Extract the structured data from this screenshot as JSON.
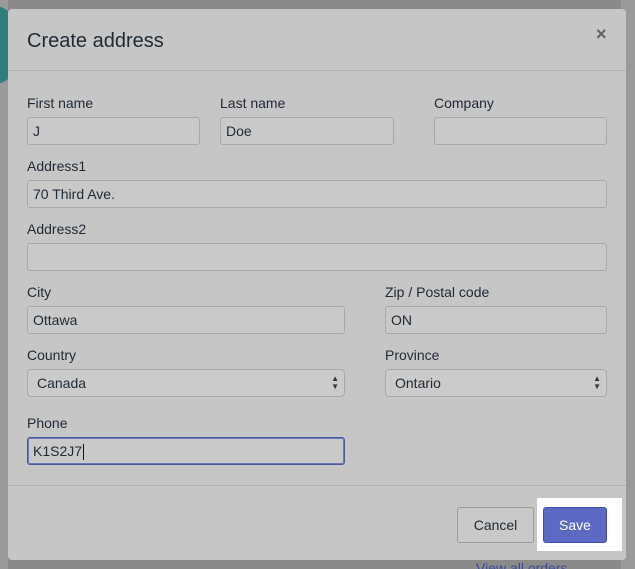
{
  "modal": {
    "title": "Create address",
    "close_glyph": "×"
  },
  "form": {
    "first_name": {
      "label": "First name",
      "value": "J"
    },
    "last_name": {
      "label": "Last name",
      "value": "Doe"
    },
    "company": {
      "label": "Company",
      "value": ""
    },
    "address1": {
      "label": "Address1",
      "value": "70 Third Ave."
    },
    "address2": {
      "label": "Address2",
      "value": ""
    },
    "city": {
      "label": "City",
      "value": "Ottawa"
    },
    "zip": {
      "label": "Zip / Postal code",
      "value": "ON"
    },
    "country": {
      "label": "Country",
      "value": "Canada"
    },
    "province": {
      "label": "Province",
      "value": "Ontario"
    },
    "phone": {
      "label": "Phone",
      "value": "K1S2J7"
    }
  },
  "footer": {
    "cancel_label": "Cancel",
    "save_label": "Save"
  },
  "background": {
    "link_text": "View all orders"
  },
  "colors": {
    "primary": "#5c6ac4",
    "overlay": "#6f6f6f"
  }
}
